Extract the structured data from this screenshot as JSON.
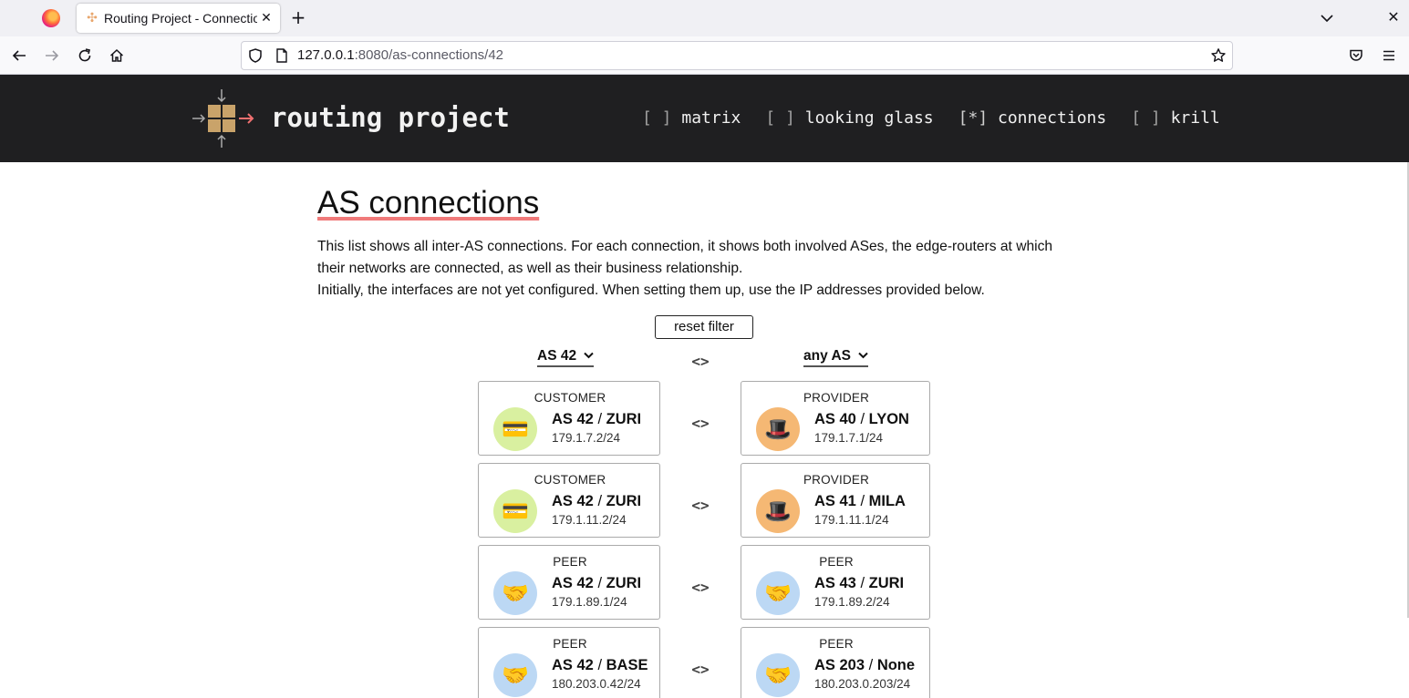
{
  "browser": {
    "tab_title": "Routing Project - Connections",
    "url_host": "127.0.0.1",
    "url_rest": ":8080/as-connections/42",
    "tab_close_glyph": "✕",
    "new_tab_glyph": "+",
    "win_close_glyph": "✕"
  },
  "header": {
    "site_title": "routing project",
    "menu": [
      {
        "bracket": "[ ]",
        "label": "matrix",
        "active": false
      },
      {
        "bracket": "[ ]",
        "label": "looking glass",
        "active": false
      },
      {
        "bracket": "[*]",
        "label": "connections",
        "active": true
      },
      {
        "bracket": "[ ]",
        "label": "krill",
        "active": false
      }
    ]
  },
  "page": {
    "title": "AS connections",
    "intro_line1": "This list shows all inter-AS connections. For each connection, it shows both involved ASes, the edge-routers at which their networks are connected, as well as their business relationship.",
    "intro_line2": "Initially, the interfaces are not yet configured. When setting them up, use the IP addresses provided below."
  },
  "filter": {
    "reset_label": "reset filter",
    "left_select": "AS 42",
    "right_select": "any AS",
    "separator": "<>"
  },
  "connections": [
    {
      "left": {
        "role": "CUSTOMER",
        "as": "AS 42",
        "router": "ZURI",
        "ip": "179.1.7.2/24",
        "icon": "💳"
      },
      "right": {
        "role": "PROVIDER",
        "as": "AS 40",
        "router": "LYON",
        "ip": "179.1.7.1/24",
        "icon": "🎩"
      },
      "sep": "<>"
    },
    {
      "left": {
        "role": "CUSTOMER",
        "as": "AS 42",
        "router": "ZURI",
        "ip": "179.1.11.2/24",
        "icon": "💳"
      },
      "right": {
        "role": "PROVIDER",
        "as": "AS 41",
        "router": "MILA",
        "ip": "179.1.11.1/24",
        "icon": "🎩"
      },
      "sep": "<>"
    },
    {
      "left": {
        "role": "PEER",
        "as": "AS 42",
        "router": "ZURI",
        "ip": "179.1.89.1/24",
        "icon": "🤝"
      },
      "right": {
        "role": "PEER",
        "as": "AS 43",
        "router": "ZURI",
        "ip": "179.1.89.2/24",
        "icon": "🤝"
      },
      "sep": "<>"
    },
    {
      "left": {
        "role": "PEER",
        "as": "AS 42",
        "router": "BASE",
        "ip": "180.203.0.42/24",
        "icon": "🤝"
      },
      "right": {
        "role": "PEER",
        "as": "AS 203",
        "router": "None",
        "ip": "180.203.0.203/24",
        "icon": "🤝"
      },
      "sep": "<>"
    }
  ],
  "colors": {
    "header_bg": "#1f1f21",
    "title_underline": "#f07a7a",
    "customer_bg": "#d9f0a0",
    "provider_bg": "#f5b874",
    "peer_bg": "#bcd8f4"
  }
}
